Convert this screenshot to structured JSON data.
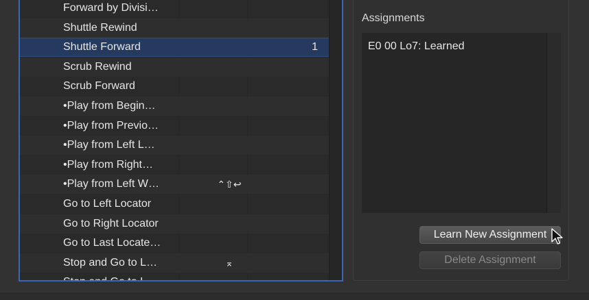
{
  "commands": {
    "rows": [
      {
        "label": "Forward by Divisi…",
        "key": "",
        "num": ""
      },
      {
        "label": "Shuttle Rewind",
        "key": "",
        "num": ""
      },
      {
        "label": "Shuttle Forward",
        "key": "",
        "num": "1",
        "selected": true
      },
      {
        "label": "Scrub Rewind",
        "key": "",
        "num": ""
      },
      {
        "label": "Scrub Forward",
        "key": "",
        "num": ""
      },
      {
        "label": "•Play from Begin…",
        "key": "",
        "num": ""
      },
      {
        "label": "•Play from Previo…",
        "key": "",
        "num": ""
      },
      {
        "label": "•Play from Left L…",
        "key": "",
        "num": ""
      },
      {
        "label": "•Play from Right…",
        "key": "",
        "num": ""
      },
      {
        "label": "•Play from Left W…",
        "key": "⌃⇧↩",
        "num": ""
      },
      {
        "label": "Go to Left Locator",
        "key": "",
        "num": ""
      },
      {
        "label": "Go to Right Locator",
        "key": "",
        "num": ""
      },
      {
        "label": "Go to Last Locate…",
        "key": "",
        "num": ""
      },
      {
        "label": "Stop and Go to L…",
        "key": "⌅",
        "num": ""
      },
      {
        "label": "Stop and Go to L…",
        "key": "",
        "num": ""
      }
    ]
  },
  "assignments": {
    "title": "Assignments",
    "items": [
      "E0 00 Lo7: Learned"
    ]
  },
  "buttons": {
    "learn": "Learn New Assignment",
    "delete": "Delete Assignment"
  },
  "colors": {
    "selection": "#253a5e",
    "focus_ring": "#3b67b8",
    "background": "#323232"
  }
}
